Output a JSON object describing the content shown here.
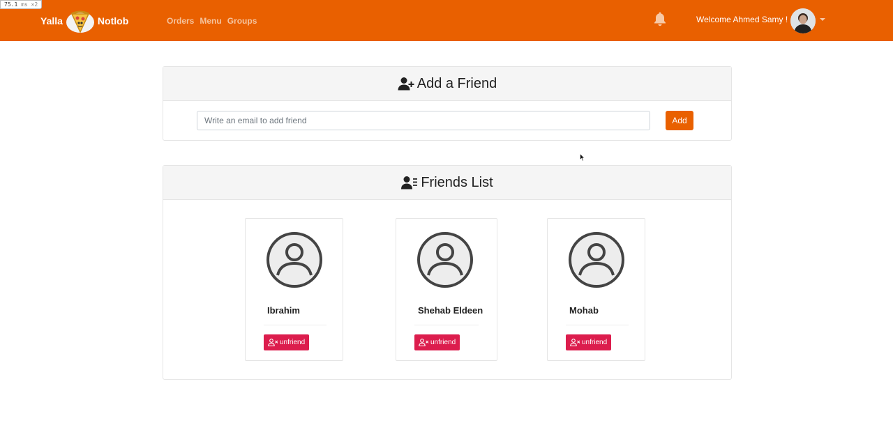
{
  "debug": {
    "value": "75.1",
    "unit": "ms ×2"
  },
  "navbar": {
    "brand_left": "Yalla",
    "brand_right": "Notlob",
    "links": [
      "Orders",
      "Menu",
      "Groups"
    ],
    "welcome": "Welcome Ahmed Samy !",
    "icons": [
      "pizza-logo-icon",
      "bell-icon",
      "chevron-down-icon"
    ]
  },
  "add_friend": {
    "title": "Add a Friend",
    "title_icon": "user-plus-icon",
    "input_placeholder": "Write an email to add friend",
    "input_value": "",
    "button_label": "Add"
  },
  "friends_list": {
    "title": "Friends List",
    "title_icon": "user-list-icon",
    "friends": [
      {
        "name": "Ibrahim",
        "button_label": "unfriend"
      },
      {
        "name": "Shehab Eldeen",
        "button_label": "unfriend"
      },
      {
        "name": "Mohab",
        "button_label": "unfriend"
      }
    ]
  },
  "colors": {
    "navbar": "#e96000",
    "add_button": "#e96000",
    "unfriend_button": "#dc1d4d",
    "nav_link": "#f5c39d"
  }
}
